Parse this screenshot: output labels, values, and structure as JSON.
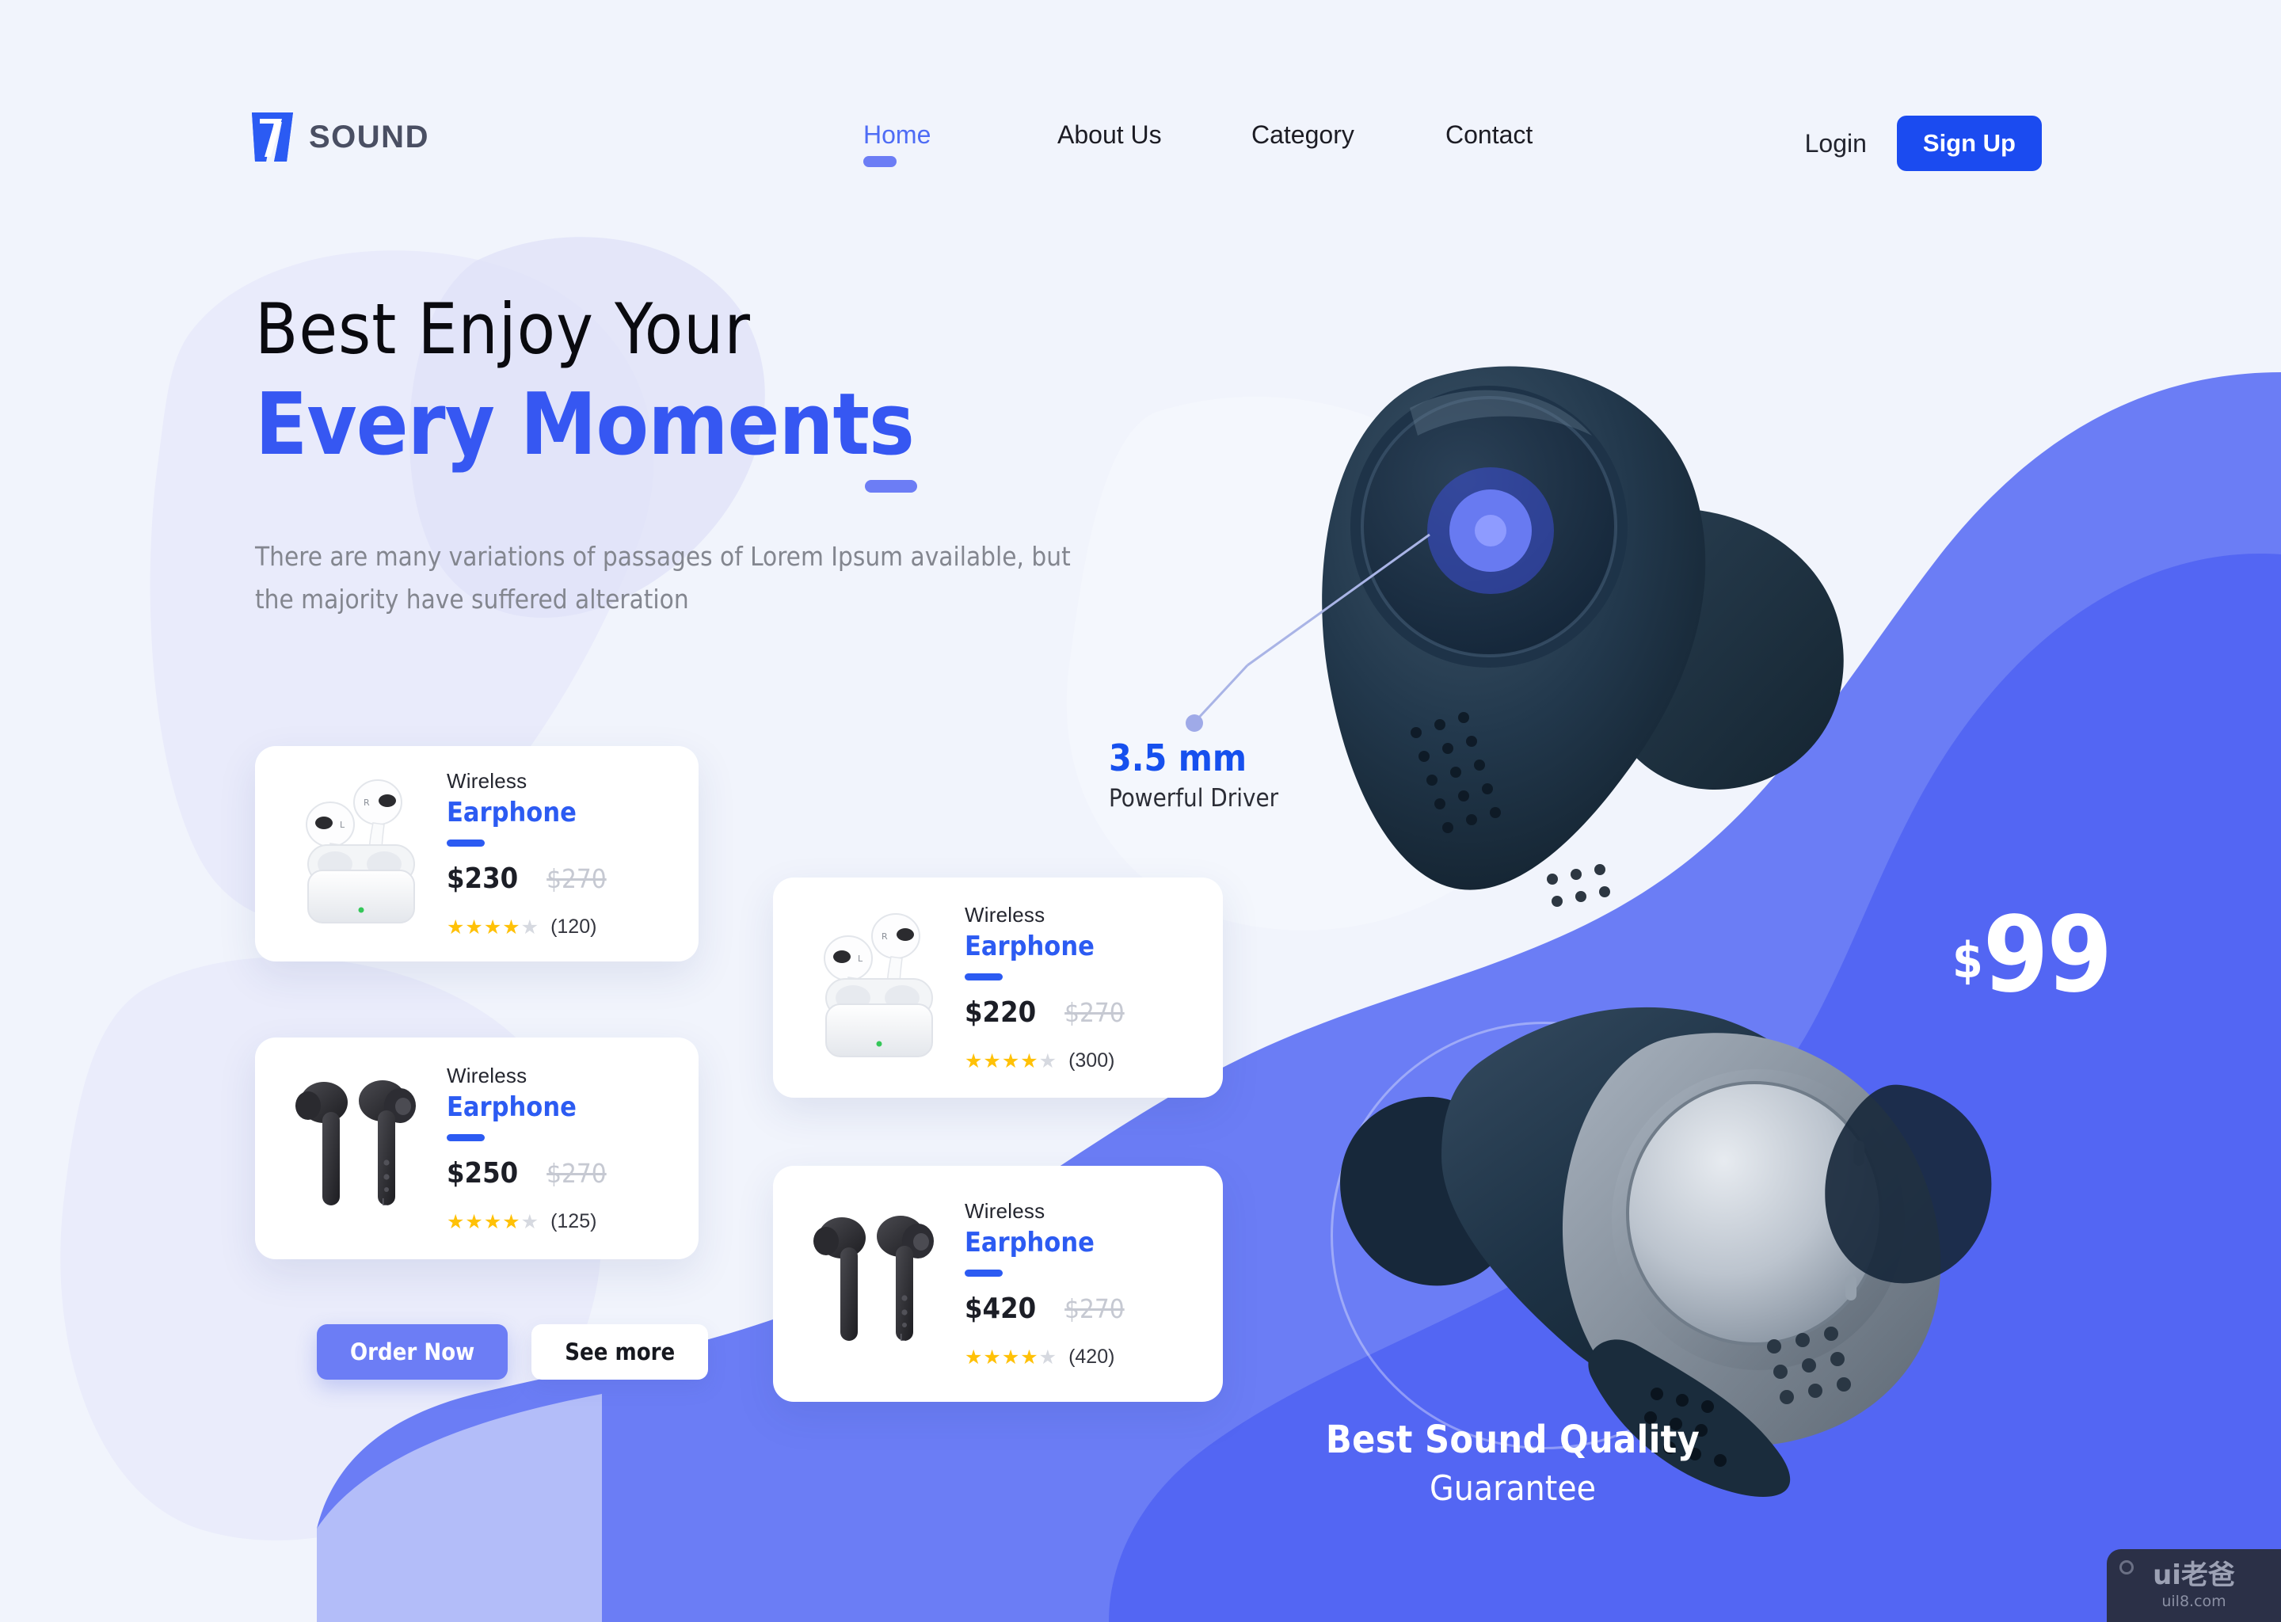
{
  "theme": {
    "page_bg": "#F1F4FC",
    "primary_blue": "#1B4BF0",
    "accent_indigo": "#6C7DF5",
    "blob_blue": "#6B7DF5",
    "blob_blue_dark": "#4B5FF5",
    "blob_lavender": "#E4E6FA",
    "star_gold": "#FFC107"
  },
  "header": {
    "logo": {
      "icon": "seven-logo-icon",
      "text": "SOUND"
    },
    "nav": [
      {
        "label": "Home",
        "active": true
      },
      {
        "label": "About Us",
        "active": false
      },
      {
        "label": "Category",
        "active": false
      },
      {
        "label": "Contact",
        "active": false
      }
    ],
    "login_label": "Login",
    "signup_label": "Sign Up"
  },
  "hero": {
    "line1": "Best Enjoy Your",
    "line2": "Every Moments",
    "subtitle": "There are many variations of passages of Lorem Ipsum available, but the majority have suffered alteration",
    "cta_primary": "Order Now",
    "cta_secondary": "See more"
  },
  "callout": {
    "value": "3.5 mm",
    "label": "Powerful Driver"
  },
  "price_badge": {
    "currency": "$",
    "amount": "99"
  },
  "guarantee": {
    "title": "Best Sound Quality",
    "subtitle": "Guarantee"
  },
  "products": [
    {
      "eyebrow": "Wireless",
      "title": "Earphone",
      "price": "$230",
      "old_price": "$270",
      "stars_filled": 4,
      "stars_total": 5,
      "rating_count": "(120)",
      "image": "white-earbuds-in-case"
    },
    {
      "eyebrow": "Wireless",
      "title": "Earphone",
      "price": "$220",
      "old_price": "$270",
      "stars_filled": 4,
      "stars_total": 5,
      "rating_count": "(300)",
      "image": "white-earbuds-in-case"
    },
    {
      "eyebrow": "Wireless",
      "title": "Earphone",
      "price": "$250",
      "old_price": "$270",
      "stars_filled": 4,
      "stars_total": 5,
      "rating_count": "(125)",
      "image": "black-stem-earbuds"
    },
    {
      "eyebrow": "Wireless",
      "title": "Earphone",
      "price": "$420",
      "old_price": "$270",
      "stars_filled": 4,
      "stars_total": 5,
      "rating_count": "(420)",
      "image": "black-stem-earbuds"
    }
  ],
  "watermark": {
    "main": "ui老爸",
    "sub": "uil8.com"
  }
}
